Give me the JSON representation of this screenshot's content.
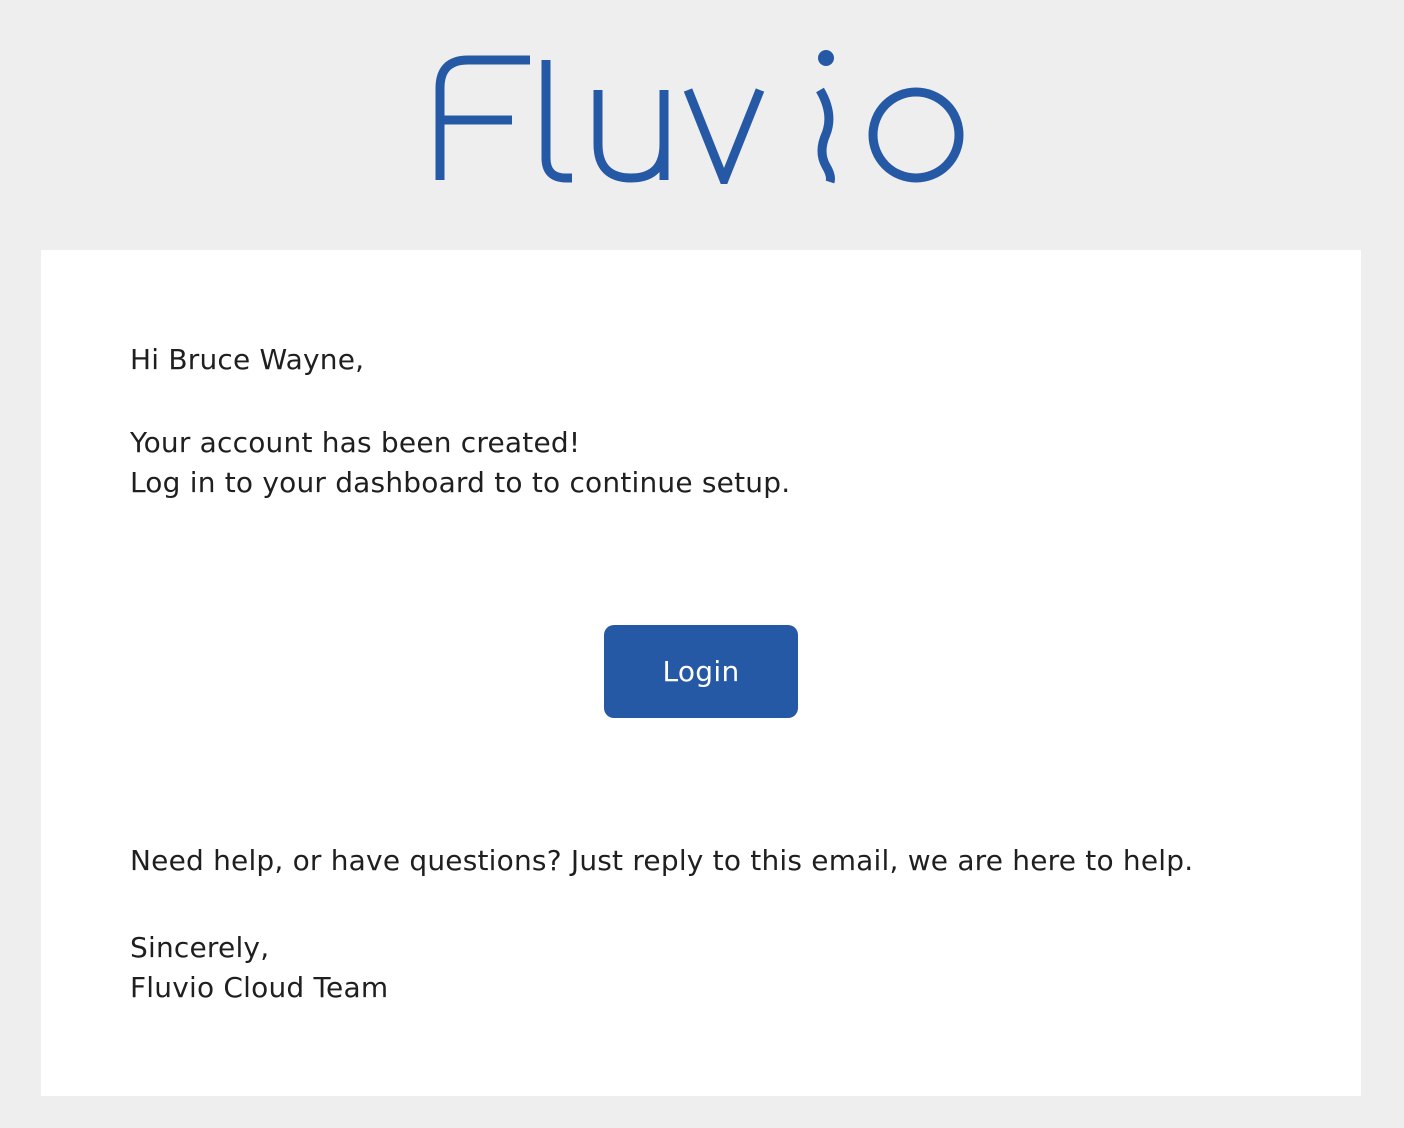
{
  "brand": {
    "logo_text": "Fluvio",
    "color": "#2659a5"
  },
  "email": {
    "greeting": "Hi Bruce Wayne,",
    "message_line1": "Your account has been created!",
    "message_line2": "Log in to your dashboard to to continue setup.",
    "login_button": "Login",
    "help_text": "Need help, or have questions? Just reply to this email, we are here to help.",
    "signoff": "Sincerely,",
    "team": "Fluvio Cloud Team"
  }
}
